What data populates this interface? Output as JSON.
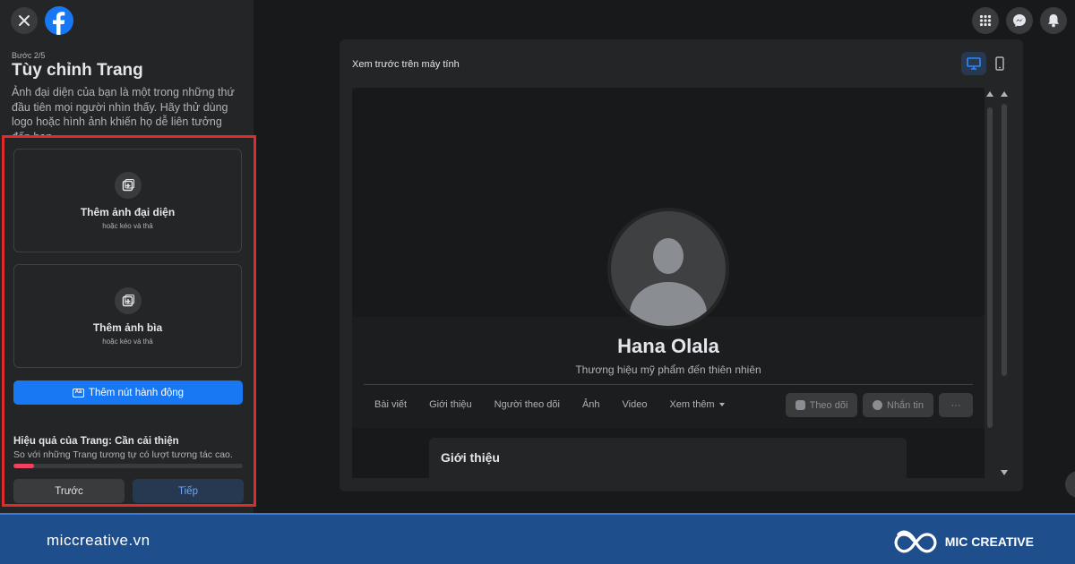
{
  "sidebar": {
    "step": "Bước 2/5",
    "title": "Tùy chỉnh Trang",
    "description": "Ảnh đại diện của bạn là một trong những thứ đầu tiên mọi người nhìn thấy. Hãy thử dùng logo hoặc hình ảnh khiến họ dễ liên tưởng đến bạn.",
    "profile_upload": {
      "label": "Thêm ảnh đại diện",
      "hint": "hoặc kéo và thả"
    },
    "cover_upload": {
      "label": "Thêm ảnh bìa",
      "hint": "hoặc kéo và thả"
    },
    "action_button": "Thêm nút hành động",
    "performance": {
      "title": "Hiệu quả của Trang: Cần cải thiện",
      "subtitle": "So với những Trang tương tự có lượt tương tác cao.",
      "progress": 0.09
    },
    "prev_button": "Trước",
    "next_button": "Tiếp"
  },
  "preview": {
    "label": "Xem trước trên máy tính",
    "page_name": "Hana Olala",
    "tagline": "Thương hiệu mỹ phẩm đến thiên nhiên",
    "tabs": [
      "Bài viết",
      "Giới thiệu",
      "Người theo dõi",
      "Ảnh",
      "Video",
      "Xem thêm"
    ],
    "follow_button": "Theo dõi",
    "message_button": "Nhắn tin",
    "more_button": "···",
    "intro_title": "Giới thiệu"
  },
  "footer": {
    "site": "miccreative.vn",
    "brand": "MIC CREATIVE"
  },
  "colors": {
    "accent": "#1877f2",
    "highlight_frame": "#e02b2b",
    "footer_bg": "#1e4f8c",
    "progress_fill": "#f3425f"
  },
  "icons": [
    "close-icon",
    "facebook-logo",
    "add-photo-icon",
    "grid-menu-icon",
    "messenger-icon",
    "bell-icon",
    "desktop-icon",
    "mobile-icon",
    "action-button-icon",
    "caret-down-icon",
    "follow-icon",
    "message-icon"
  ]
}
